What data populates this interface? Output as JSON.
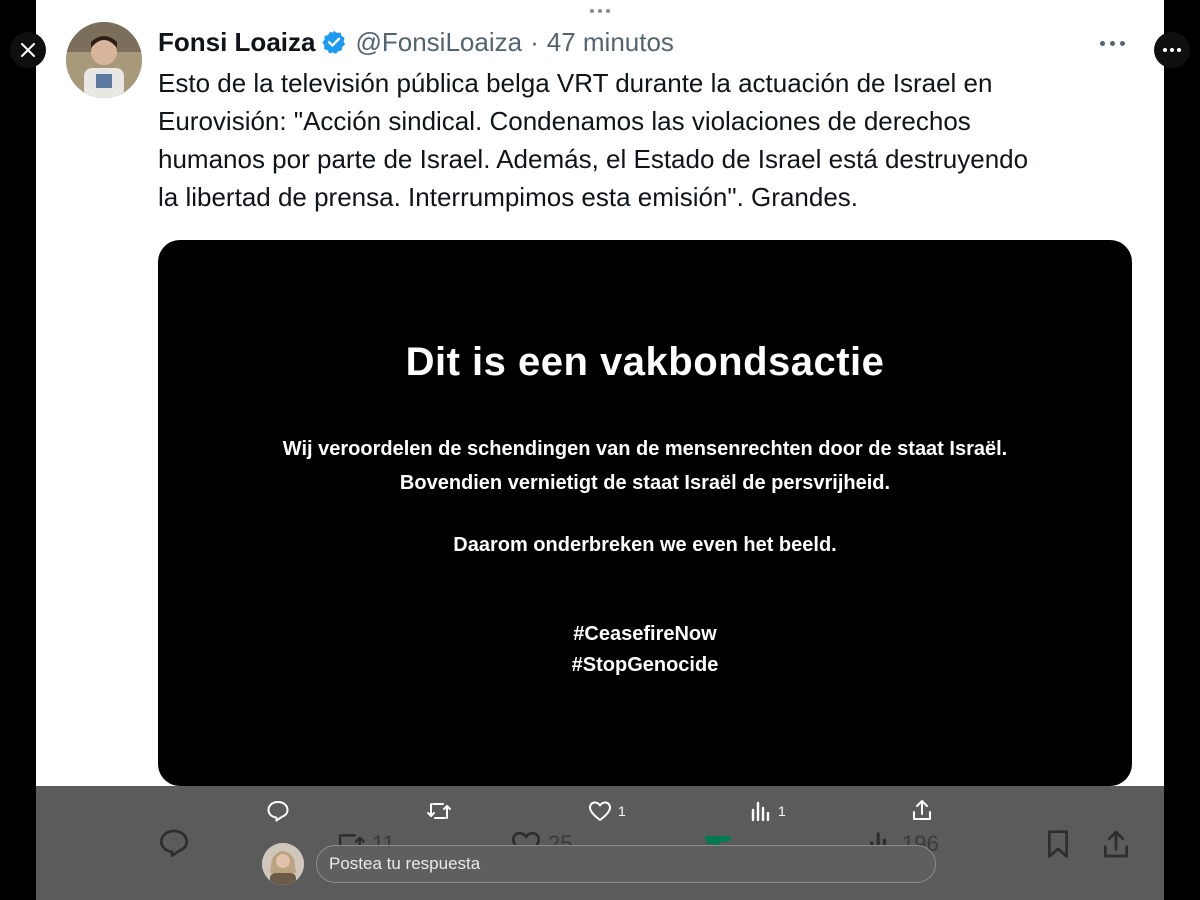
{
  "tweet": {
    "author_name": "Fonsi Loaiza",
    "handle": "@FonsiLoaiza",
    "separator": "·",
    "time": "47 minutos",
    "text_lines": [
      "Esto de la televisión pública belga VRT durante la actuación de Israel en",
      "Eurovisión: \"Acción sindical. Condenamos las violaciones de derechos",
      "humanos por parte de Israel. Además, el Estado de Israel está destruyendo",
      "la libertad de prensa. Interrumpimos esta emisión\". Grandes."
    ]
  },
  "media": {
    "title": "Dit is een vakbondsactie",
    "line1": "Wij veroordelen de schendingen van de mensenrechten door de staat Israël.",
    "line2": "Bovendien vernietigt de staat Israël de persvrijheid.",
    "line3": "Daarom onderbreken we even het beeld.",
    "hashtag1": "#CeasefireNow",
    "hashtag2": "#StopGenocide"
  },
  "overlay_actions": {
    "like_count": "1",
    "views_count": "1"
  },
  "actions": {
    "retweets": "11",
    "likes": "25",
    "views": "196"
  },
  "reply": {
    "placeholder": "Postea tu respuesta"
  },
  "colors": {
    "verified_blue": "#1d9bf0",
    "muted_text": "#536471",
    "overlay_bar": "#5b5b5b",
    "accent_green": "#00ba7c"
  }
}
